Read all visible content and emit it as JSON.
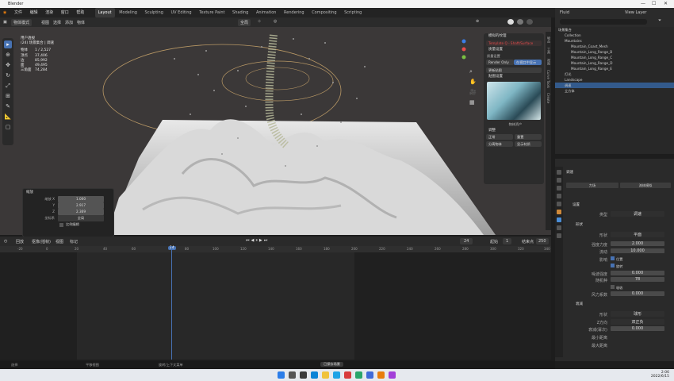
{
  "os": {
    "title": "Blender"
  },
  "menu": {
    "items": [
      "文件",
      "编辑",
      "渲染",
      "窗口",
      "帮助"
    ]
  },
  "workspaces": {
    "tabs": [
      "Layout",
      "Modeling",
      "Sculpting",
      "UV Editing",
      "Texture Paint",
      "Shading",
      "Animation",
      "Rendering",
      "Compositing",
      "Scripting"
    ],
    "active": "Layout"
  },
  "scene": {
    "name": "Fluid",
    "view_layer": "View Layer"
  },
  "viewport_header": {
    "mode": "物体模式",
    "view": "视图",
    "select": "选择",
    "add": "添加",
    "object": "物体",
    "transform": "全局"
  },
  "stats": {
    "title": "用户透视",
    "subtitle": "(24) 场景集合 | 调速",
    "rows": [
      {
        "k": "物体",
        "v": "1 / 2,527"
      },
      {
        "k": "顶点",
        "v": "37,406"
      },
      {
        "k": "边",
        "v": "85,992"
      },
      {
        "k": "面",
        "v": "49,495"
      },
      {
        "k": "三角面",
        "v": "74,284"
      }
    ],
    "frame_label": "帧数: 24"
  },
  "npanel": {
    "header1": "模拟的纹理",
    "addon": "Template Q - Shaft/Surface",
    "header2": "质量设置",
    "quality_label": "质量设置",
    "opt_a": "Render Only",
    "opt_b": "在视口中显示",
    "btn_update": "更新贴图",
    "header3": "贴图设置",
    "image_caption": "物体资产",
    "header4": "调整",
    "btn_a": "正常",
    "btn_b": "重置",
    "btn_c": "分离物体",
    "btn_d": "显示材质"
  },
  "sidetabs": [
    "物品",
    "工具",
    "视图",
    "Curve Tools",
    "Create"
  ],
  "operator": {
    "title": "缩放",
    "rows": [
      {
        "label": "缩放 X",
        "value": "1.000"
      },
      {
        "label": "Y",
        "value": "2.917"
      },
      {
        "label": "Z",
        "value": "2.369"
      },
      {
        "label": "坐标系",
        "value": "全局"
      }
    ],
    "checkbox": "比例编辑"
  },
  "timeline": {
    "menus": [
      "回放",
      "抠像(插帧)",
      "视图",
      "标记"
    ],
    "ticks": [
      "-20",
      "0",
      "20",
      "40",
      "60",
      "80",
      "100",
      "120",
      "140",
      "160",
      "180",
      "200",
      "220",
      "240",
      "260",
      "280",
      "300",
      "320",
      "340"
    ],
    "current_frame": "24",
    "start_label": "起始",
    "start": "1",
    "end_label": "结束点",
    "end": "250"
  },
  "statusbar": {
    "left": "选择",
    "mid1": "平移视图",
    "mid2": "旋转/上下文菜单",
    "right": "场景集合 | 调速 | 顶点 37,406/37,406 | 面 49,495/49,495 | 三角面 74,284"
  },
  "notification": "已保存场景",
  "outliner": {
    "rows": [
      {
        "name": "场景集合",
        "sel": false,
        "indent": 0
      },
      {
        "name": "Collection",
        "sel": false,
        "indent": 1
      },
      {
        "name": "Mountains",
        "sel": false,
        "indent": 1
      },
      {
        "name": "Mountain_Coast_Mesh",
        "sel": false,
        "indent": 2
      },
      {
        "name": "Mountain_Long_Range_B",
        "sel": false,
        "indent": 2
      },
      {
        "name": "Mountain_Long_Range_C",
        "sel": false,
        "indent": 2
      },
      {
        "name": "Mountain_Long_Range_D",
        "sel": false,
        "indent": 2
      },
      {
        "name": "Mountain_Long_Range_E",
        "sel": false,
        "indent": 2
      },
      {
        "name": "灯光",
        "sel": false,
        "indent": 1
      },
      {
        "name": "Landscape",
        "sel": false,
        "indent": 1
      },
      {
        "name": "调速",
        "sel": true,
        "indent": 1
      },
      {
        "name": "立方体",
        "sel": false,
        "indent": 1
      }
    ]
  },
  "properties": {
    "object": "调速",
    "buttons": [
      "力场",
      "流体模拟"
    ],
    "section_settings": "设置",
    "type_label": "类型",
    "type_value": "调速",
    "section_shape": "形状",
    "shape_label": "形状",
    "shape_value": "平面",
    "strength_label": "强度力度",
    "strength": "2.000",
    "flow_label": "流动",
    "flow": "10.000",
    "affect": "影响",
    "cb1": "位置",
    "cb2": "旋转",
    "noise_label": "噪波强度",
    "noise": "0.000",
    "seed_label": "随机种",
    "seed": "78",
    "absorb": "吸收",
    "wind_label": "风力系数",
    "wind": "0.000",
    "section_falloff": "衰减",
    "falloff_label": "形状",
    "falloff_value": "球形",
    "dir_label": "Z方向",
    "dir_value": "双正负",
    "power_label": "衰减(幂次)",
    "power": "0.000",
    "min_label": "最小距离",
    "max_label": "最大距离"
  },
  "taskbar": {
    "time": "2:06",
    "date": "2022/6/15"
  },
  "colors": {
    "accent": "#4772b3",
    "selection": "#335a8c",
    "viewport": "#3b3838"
  }
}
